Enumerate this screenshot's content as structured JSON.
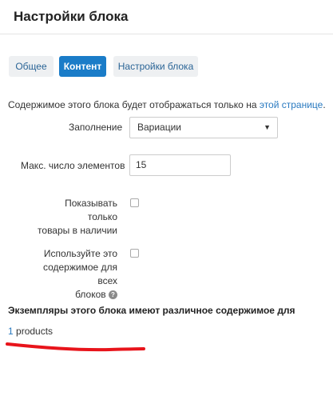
{
  "header": {
    "title": "Настройки блока"
  },
  "tabs": [
    {
      "label": "Общее",
      "active": false
    },
    {
      "label": "Контент",
      "active": true
    },
    {
      "label": "Настройки блока",
      "active": false
    }
  ],
  "intro": {
    "text": "Содержимое этого блока будет отображаться только на ",
    "link": "этой странице",
    "suffix": "."
  },
  "form": {
    "fill": {
      "label": "Заполнение",
      "value": "Вариации",
      "caret": "▼"
    },
    "max_items": {
      "label": "Макс. число элементов",
      "value": "15"
    },
    "in_stock": {
      "label_line1": "Показывать только",
      "label_line2": "товары в наличии",
      "checked": false
    },
    "use_for_all": {
      "label_line1": "Используйте это",
      "label_line2": "содержимое для всех",
      "label_line3": "блоков",
      "help_icon": "question-circle-icon",
      "help_glyph": "?",
      "checked": false
    }
  },
  "instances": {
    "heading": "Экземпляры этого блока имеют различное содержимое для",
    "count": "1",
    "label": " products"
  },
  "colors": {
    "accent": "#1a7cc8",
    "link": "#2a7ac0",
    "annotation": "#e8141b"
  }
}
